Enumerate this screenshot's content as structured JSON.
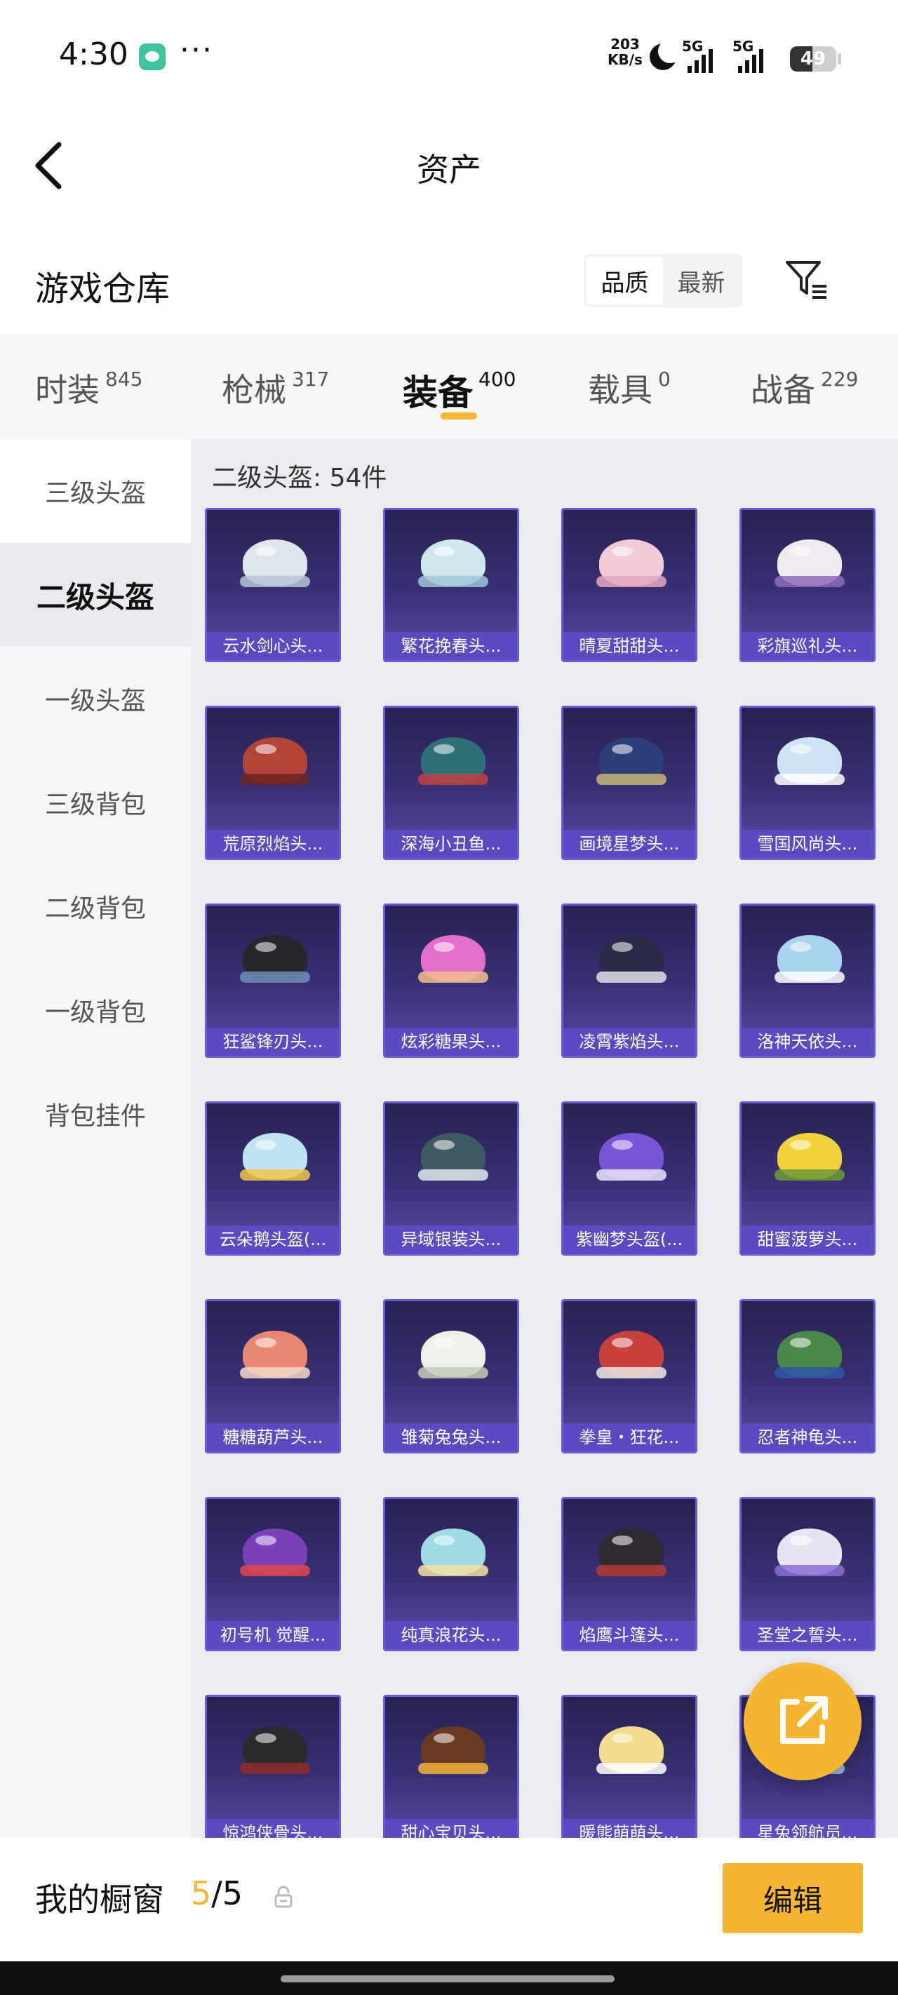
{
  "status_bar": {
    "time": "4:30",
    "dots": "···",
    "speed_value": "203",
    "speed_unit": "KB/s",
    "net1": "5G",
    "net2": "5G",
    "battery": "49",
    "battery_fraction": 0.49,
    "icons": [
      "wechat-icon",
      "moon-icon",
      "signal-icon",
      "battery-icon"
    ]
  },
  "nav": {
    "title": "资产",
    "back_icon": "chevron-left-icon"
  },
  "section": {
    "title": "游戏仓库",
    "sort_options": [
      "品质",
      "最新"
    ],
    "active_sort": "品质",
    "filter_icon": "filter-icon"
  },
  "tabs": [
    {
      "label": "时装",
      "count": "845"
    },
    {
      "label": "枪械",
      "count": "317"
    },
    {
      "label": "装备",
      "count": "400"
    },
    {
      "label": "载具",
      "count": "0"
    },
    {
      "label": "战备",
      "count": "229"
    }
  ],
  "active_tab": "装备",
  "side_nav": [
    "三级头盔",
    "二级头盔",
    "一级头盔",
    "三级背包",
    "二级背包",
    "一级背包",
    "背包挂件"
  ],
  "active_side": "二级头盔",
  "grid": {
    "heading": "二级头盔: 54件",
    "items": [
      {
        "name": "云水剑心头...",
        "color": "#dfe6ee",
        "rim": "#b8c3d6"
      },
      {
        "name": "繁花挽春头...",
        "color": "#cfe8f0",
        "rim": "#9fc6d8"
      },
      {
        "name": "晴夏甜甜头...",
        "color": "#f4c9d8",
        "rim": "#e6a8bf"
      },
      {
        "name": "彩旗巡礼头...",
        "color": "#efe9f2",
        "rim": "#8d6bb8"
      },
      {
        "name": "荒原烈焰头...",
        "color": "#b4433a",
        "rim": "#6e2720"
      },
      {
        "name": "深海小丑鱼...",
        "color": "#2f6f7a",
        "rim": "#c24141"
      },
      {
        "name": "画境星梦头...",
        "color": "#2c3f78",
        "rim": "#c9b673"
      },
      {
        "name": "雪国风尚头...",
        "color": "#cfe3f7",
        "rim": "#ffffff"
      },
      {
        "name": "狂鲨锋刃头...",
        "color": "#26262c",
        "rim": "#6c8fb8"
      },
      {
        "name": "炫彩糖果头...",
        "color": "#e46fc9",
        "rim": "#f3c18a"
      },
      {
        "name": "凌霄紫焰头...",
        "color": "#2b2a4a",
        "rim": "#e0e0ea"
      },
      {
        "name": "洛神天依头...",
        "color": "#a9d4f0",
        "rim": "#ffffff"
      },
      {
        "name": "云朵鹅头盔(...",
        "color": "#bfe3f2",
        "rim": "#f1c64a"
      },
      {
        "name": "异域银装头...",
        "color": "#3d5a63",
        "rim": "#dfe8ee"
      },
      {
        "name": "紫幽梦头盔(...",
        "color": "#7a55d8",
        "rim": "#e9e4fb"
      },
      {
        "name": "甜蜜菠萝头...",
        "color": "#f1d23b",
        "rim": "#6c9b3a"
      },
      {
        "name": "糖糖葫芦头...",
        "color": "#e98872",
        "rim": "#f5d8c8"
      },
      {
        "name": "雏菊兔兔头...",
        "color": "#eef0ea",
        "rim": "#c3cbb8"
      },
      {
        "name": "拳皇・狂花...",
        "color": "#c7423e",
        "rim": "#eee7e3"
      },
      {
        "name": "忍者神龟头...",
        "color": "#4a8a48",
        "rim": "#2e55a8"
      },
      {
        "name": "初号机 觉醒...",
        "color": "#7b3fb8",
        "rim": "#e0484a"
      },
      {
        "name": "纯真浪花头...",
        "color": "#9fdbe6",
        "rim": "#f4e2a1"
      },
      {
        "name": "焰鹰斗篷头...",
        "color": "#2e2a30",
        "rim": "#b23a32"
      },
      {
        "name": "圣堂之誓头...",
        "color": "#e8e4f4",
        "rim": "#8b6dd4"
      },
      {
        "name": "惊鸿侠骨头...",
        "color": "#2b2b2e",
        "rim": "#8a2d2a"
      },
      {
        "name": "甜心宝贝头...",
        "color": "#6a3a20",
        "rim": "#f0b23d"
      },
      {
        "name": "暖熊萌萌头...",
        "color": "#f3dc8e",
        "rim": "#ffffff"
      },
      {
        "name": "星兔领航员...",
        "color": "#3b4a64",
        "rim": "#9fc6d8"
      }
    ]
  },
  "fab_icon": "share-external-icon",
  "bottom_bar": {
    "title": "我的橱窗",
    "current": "5",
    "total": "/5",
    "lock_icon": "lock-icon",
    "edit_label": "编辑"
  }
}
